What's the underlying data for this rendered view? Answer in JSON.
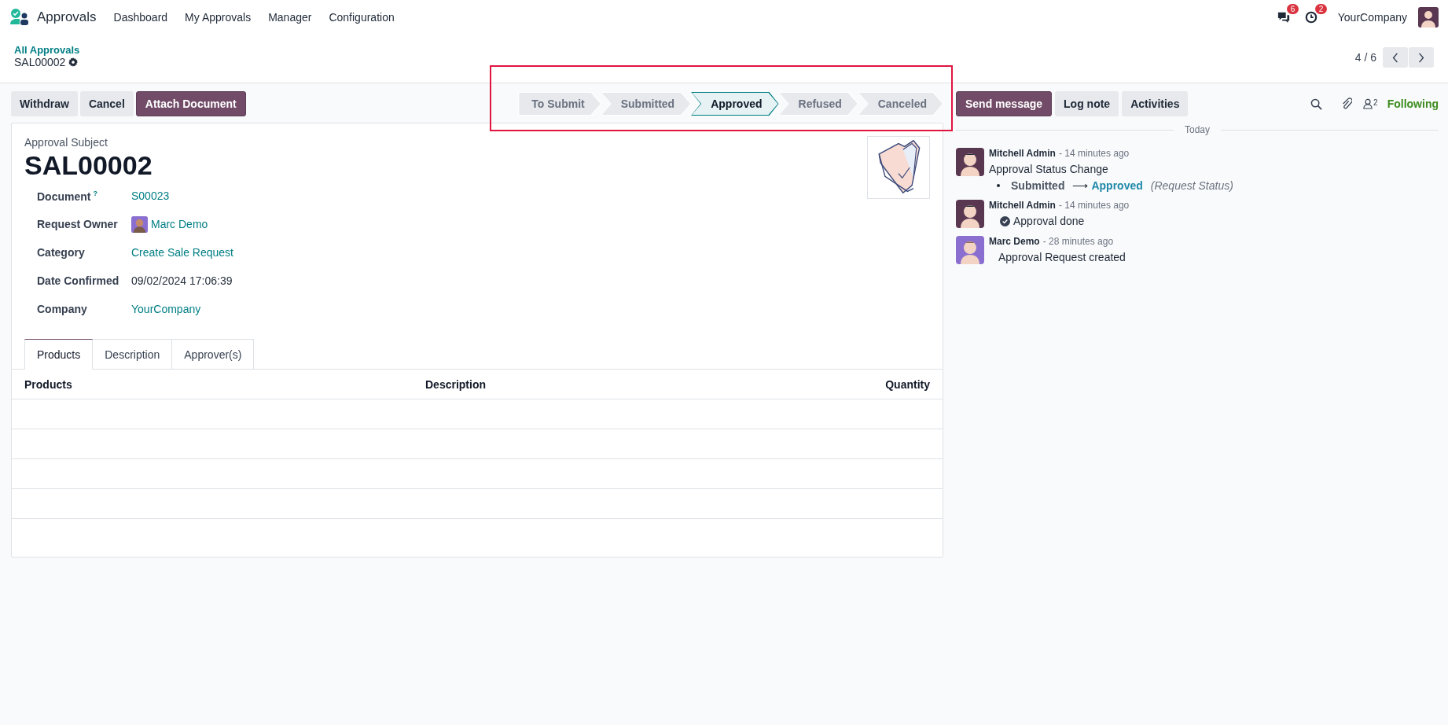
{
  "app": {
    "name": "Approvals",
    "menu": [
      "Dashboard",
      "My Approvals",
      "Manager",
      "Configuration"
    ]
  },
  "systray": {
    "messages_badge": "6",
    "activities_badge": "2",
    "company": "YourCompany"
  },
  "breadcrumb": {
    "parent": "All Approvals",
    "current": "SAL00002"
  },
  "pager": {
    "value": "4 / 6"
  },
  "actions": [
    {
      "label": "Withdraw",
      "primary": false
    },
    {
      "label": "Cancel",
      "primary": false
    },
    {
      "label": "Attach Document",
      "primary": true
    }
  ],
  "statusbar": {
    "highlighted": true,
    "stages": [
      {
        "label": "To Submit",
        "selected": false
      },
      {
        "label": "Submitted",
        "selected": false
      },
      {
        "label": "Approved",
        "selected": true
      },
      {
        "label": "Refused",
        "selected": false
      },
      {
        "label": "Canceled",
        "selected": false
      }
    ]
  },
  "form": {
    "subject_label": "Approval Subject",
    "subject": "SAL00002",
    "fields": [
      {
        "label": "Document",
        "help": "?",
        "value": "S00023",
        "kind": "link"
      },
      {
        "label": "Request Owner",
        "value": "Marc Demo",
        "kind": "user"
      },
      {
        "label": "Category",
        "value": "Create Sale Request",
        "kind": "link"
      },
      {
        "label": "Date Confirmed",
        "value": "09/02/2024 17:06:39",
        "kind": "text"
      },
      {
        "label": "Company",
        "value": "YourCompany",
        "kind": "link"
      }
    ],
    "tabs": [
      {
        "label": "Products",
        "selected": true
      },
      {
        "label": "Description",
        "selected": false
      },
      {
        "label": "Approver(s)",
        "selected": false
      }
    ],
    "table": {
      "columns": [
        "Products",
        "Description",
        "Quantity"
      ]
    }
  },
  "chatter": {
    "buttons": [
      {
        "label": "Send message",
        "primary": true
      },
      {
        "label": "Log note",
        "primary": false
      },
      {
        "label": "Activities",
        "primary": false
      }
    ],
    "followers_count": "2",
    "following": "Following",
    "date_divider": "Today",
    "messages": [
      {
        "author": "Mitchell Admin",
        "time": "- 14 minutes ago",
        "kind": "tracking",
        "body": "Approval Status Change",
        "old_value": "Submitted",
        "arrow": "⟶",
        "new_value": "Approved",
        "field": "(Request Status)"
      },
      {
        "author": "Mitchell Admin",
        "time": "- 14 minutes ago",
        "kind": "done",
        "body": "Approval done"
      },
      {
        "author": "Marc Demo",
        "time": "- 28 minutes ago",
        "kind": "text",
        "body": "Approval Request created"
      }
    ]
  }
}
